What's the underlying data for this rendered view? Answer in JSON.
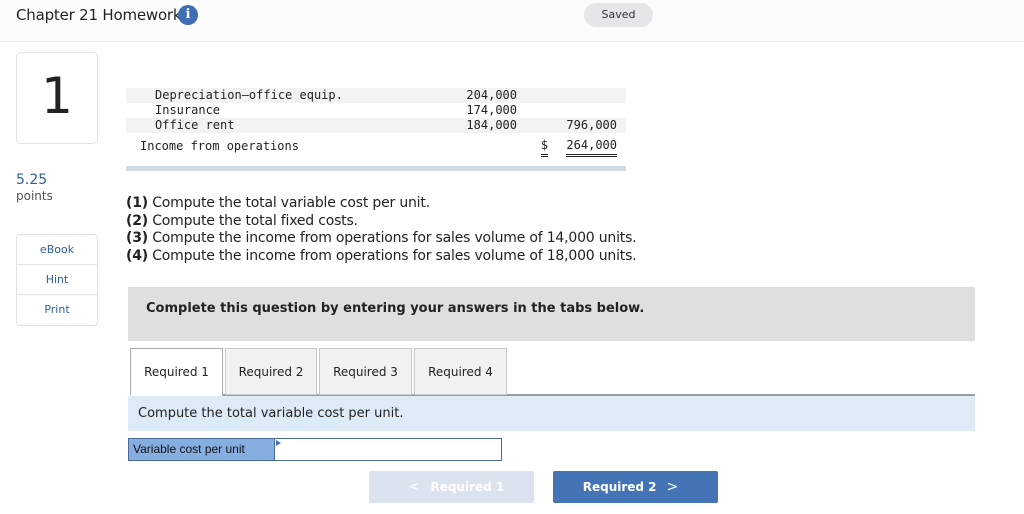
{
  "header": {
    "title": "Chapter 21 Homework",
    "info_icon": "info-circle-icon",
    "status_badge": "Saved"
  },
  "sidebar": {
    "question_number": "1",
    "points_value": "5.25",
    "points_label": "points",
    "tools": [
      {
        "label": "eBook"
      },
      {
        "label": "Hint"
      },
      {
        "label": "Print"
      }
    ]
  },
  "income_statement": {
    "rows": [
      {
        "label": "Depreciation—office equip.",
        "col1": "204,000",
        "col2": "",
        "shaded": true
      },
      {
        "label": "Insurance",
        "col1": "174,000",
        "col2": "",
        "shaded": false
      },
      {
        "label": "Office rent",
        "col1": "184,000",
        "col2": "796,000",
        "shaded": true
      }
    ],
    "total": {
      "label": "Income from operations",
      "currency": "$",
      "value": "264,000"
    }
  },
  "requirements": [
    {
      "num": "(1)",
      "text": " Compute the total variable cost per unit."
    },
    {
      "num": "(2)",
      "text": " Compute the total fixed costs."
    },
    {
      "num": "(3)",
      "text": " Compute the income from operations for sales volume of 14,000 units."
    },
    {
      "num": "(4)",
      "text": " Compute the income from operations for sales volume of 18,000 units."
    }
  ],
  "banner": {
    "text": "Complete this question by entering your answers in the tabs below."
  },
  "tabs": [
    {
      "label": "Required 1",
      "active": true
    },
    {
      "label": "Required 2",
      "active": false
    },
    {
      "label": "Required 3",
      "active": false
    },
    {
      "label": "Required 4",
      "active": false
    }
  ],
  "panel": {
    "prompt": "Compute the total variable cost per unit.",
    "answer_label": "Variable cost per unit",
    "answer_value": ""
  },
  "navigation": {
    "prev_label": "Required 1",
    "prev_icon": "chevron-left-icon",
    "prev_disabled": true,
    "next_label": "Required 2",
    "next_icon": "chevron-right-icon"
  },
  "colors": {
    "accent": "#4473b6",
    "link": "#2d5f9a",
    "panel_bg": "#ddebf7",
    "banner_bg": "#dfdfdf"
  }
}
